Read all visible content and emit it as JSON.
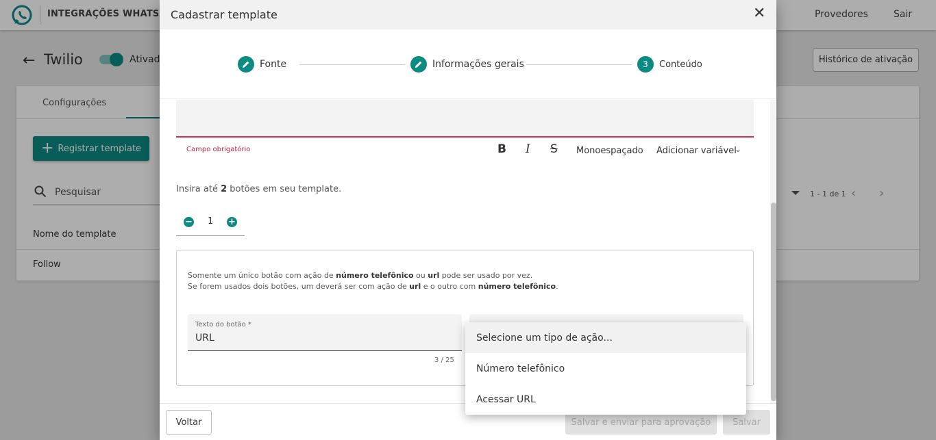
{
  "app": {
    "brand_title": "INTEGRAÇÕES WHATSAPP",
    "nav": [
      "Provedores",
      "Sair"
    ],
    "colors": {
      "primary": "#0d8a82",
      "error": "#c8243f"
    }
  },
  "page": {
    "title": "Twilio",
    "toggle_label": "Ativado",
    "history_button": "Histórico de ativação",
    "tabs": [
      "Configurações"
    ],
    "register_button": "Registrar template",
    "search_placeholder": "Pesquisar",
    "table": {
      "headers": [
        "Nome do template"
      ],
      "rows": [
        [
          "Follow"
        ]
      ]
    },
    "pager": {
      "range": "1 - 1 de 1"
    }
  },
  "modal": {
    "title": "Cadastrar template",
    "steps": [
      {
        "label": "Fonte",
        "state": "done",
        "icon": "pencil-icon"
      },
      {
        "label": "Informações gerais",
        "state": "done",
        "icon": "pencil-icon"
      },
      {
        "label": "Conteúdo",
        "state": "active",
        "number": "3"
      }
    ],
    "body": {
      "required_hint": "Campo obrigatório",
      "toolbar": {
        "bold": "B",
        "italic": "I",
        "strike": "S",
        "mono": "Monoespaçado",
        "add_variable": "Adicionar variável"
      },
      "buttons_hint": {
        "prefix": "Insira até ",
        "max": "2",
        "suffix": " botões em seu template."
      },
      "counter_value": "1",
      "note": {
        "line1_a": "Somente um único botão com ação de ",
        "line1_b": "número telefônico",
        "line1_c": " ou ",
        "line1_d": "url",
        "line1_e": " pode ser usado por vez.",
        "line2_a": "Se forem usados dois botões, um deverá ser com ação de ",
        "line2_b": "url",
        "line2_c": " e o outro com ",
        "line2_d": "número telefônico",
        "line2_e": "."
      },
      "button_text_field": {
        "label": "Texto do botão *",
        "value": "URL",
        "counter": "3 / 25"
      }
    },
    "footer": {
      "back": "Voltar",
      "send": "Salvar e enviar para aprovação",
      "save": "Salvar"
    }
  },
  "dropdown": {
    "options": [
      {
        "label": "Selecione um tipo de ação...",
        "selected": true
      },
      {
        "label": "Número telefônico",
        "selected": false
      },
      {
        "label": "Acessar URL",
        "selected": false
      }
    ]
  }
}
